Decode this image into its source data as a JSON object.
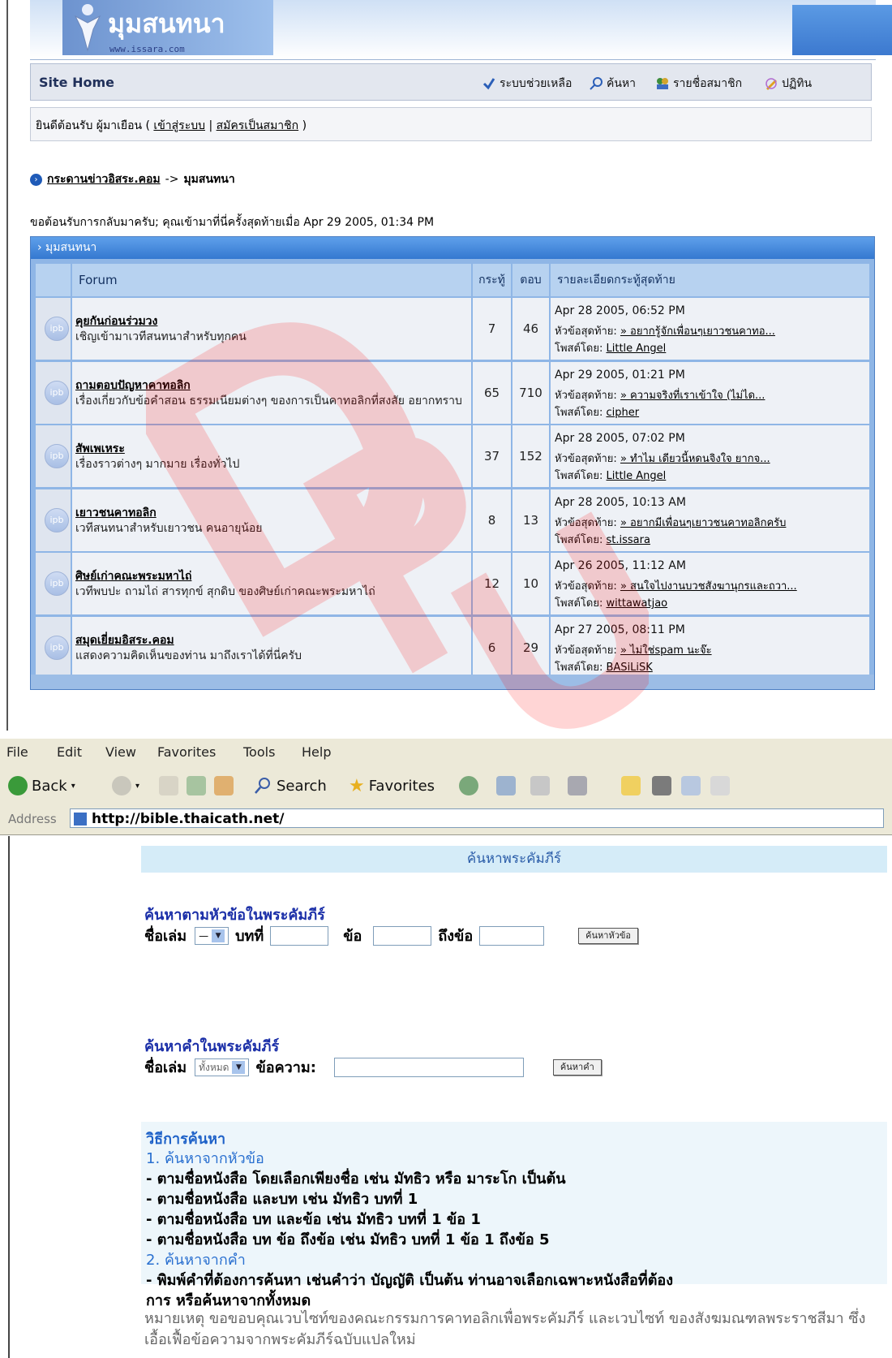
{
  "forum": {
    "site_title": "มุมสนทนา",
    "site_url": "www.issara.com",
    "nav": {
      "home": "Site Home",
      "help": "ระบบช่วยเหลือ",
      "search": "ค้นหา",
      "members": "รายชื่อสมาชิก",
      "calendar": "ปฏิทิน"
    },
    "welcome": {
      "prefix": "ยินดีต้อนรับ ผู้มาเยือน (",
      "login": "เข้าสู่ระบบ",
      "sep": "|",
      "register": "สมัครเป็นสมาชิก",
      "suffix": ")"
    },
    "breadcrumb": {
      "root": "กระดานข่าวอิสระ.คอม",
      "arrow": "->",
      "current": "มุมสนทนา"
    },
    "last_visit": "ขอต้อนรับการกลับมาครับ; คุณเข้ามาที่นี่ครั้งสุดท้ายเมื่อ Apr 29 2005, 01:34 PM",
    "table": {
      "title": "› มุมสนทนา",
      "headers": {
        "forum": "Forum",
        "topics": "กระทู้",
        "replies": "ตอบ",
        "last_post": "รายละเอียดกระทู้สุดท้าย"
      },
      "last_topic_label": "หัวข้อสุดท้าย:",
      "posted_by_label": "โพสต์โดย:",
      "rows": [
        {
          "title": "คุยกันก่อนร่วมวง",
          "desc": "เชิญเข้ามาเวทีสนทนาสำหรับทุกคน",
          "topics": "7",
          "replies": "46",
          "date": "Apr 28 2005, 06:52 PM",
          "last_topic": "» อยากรู้จักเพื่อนๆเยาวชนคาทอ...",
          "author": "Little Angel"
        },
        {
          "title": "ถามตอบปัญหาคาทอลิก",
          "desc": "เรื่องเกี่ยวกับข้อคำสอน ธรรมเนียมต่างๆ ของการเป็นคาทอลิกที่สงสัย อยากทราบ",
          "topics": "65",
          "replies": "710",
          "date": "Apr 29 2005, 01:21 PM",
          "last_topic": "» ความจริงที่เราเข้าใจ (ไม่ได...",
          "author": "cipher"
        },
        {
          "title": "สัพเพเหระ",
          "desc": "เรื่องราวต่างๆ มากมาย เรื่องทั่วไป",
          "topics": "37",
          "replies": "152",
          "date": "Apr 28 2005, 07:02 PM",
          "last_topic": "» ทำไม เดียวนี้หดนจิงใจ ยากจ...",
          "author": "Little Angel"
        },
        {
          "title": "เยาวชนคาทอลิก",
          "desc": "เวทีสนทนาสำหรับเยาวชน คนอายุน้อย",
          "topics": "8",
          "replies": "13",
          "date": "Apr 28 2005, 10:13 AM",
          "last_topic": "» อยากมีเพื่อนๆเยาวชนคาทอลิกครับ",
          "author": "st.issara"
        },
        {
          "title": "ศิษย์เก่าคณะพระมหาไถ่",
          "desc": "เวทีพบปะ ถามไถ่ สารทุกข์ สุกดิบ ของศิษย์เก่าคณะพระมหาไถ่",
          "topics": "12",
          "replies": "10",
          "date": "Apr 26 2005, 11:12 AM",
          "last_topic": "» สนใจไปงานบวชสังฆานุกรและถวา...",
          "author": "wittawatjao"
        },
        {
          "title": "สมุดเยี่ยมอิสระ.คอม",
          "desc": "แสดงความคิดเห็นของท่าน มาถึงเราได้ที่นี่ครับ",
          "topics": "6",
          "replies": "29",
          "date": "Apr 27 2005, 08:11 PM",
          "last_topic": "» ไม่ใช่spam นะจ๊ะ",
          "author": "BASiLiSK"
        }
      ]
    }
  },
  "browser": {
    "menu": [
      "File",
      "Edit",
      "View",
      "Favorites",
      "Tools",
      "Help"
    ],
    "toolbar": {
      "back": "Back",
      "search": "Search",
      "favorites": "Favorites"
    },
    "address_label": "Address",
    "address_url": "http://bible.thaicath.net/",
    "page": {
      "header": "ค้นหาพระคัมภีร์",
      "topic_search_title": "ค้นหาตามหัวข้อในพระคัมภีร์",
      "book_label": "ชื่อเล่ม",
      "book_default": "—",
      "chapter_label": "บทที่",
      "verse_label": "ข้อ",
      "to_verse_label": "ถึงข้อ",
      "topic_button": "ค้นหาหัวข้อ",
      "word_search_title": "ค้นหาคำในพระคัมภีร์",
      "word_book_default": "ทั้งหมด",
      "message_label": "ข้อความ:",
      "word_button": "ค้นหาคำ",
      "how_title": "วิธีการค้นหา",
      "how_lines": [
        {
          "text": "1. ค้นหาจากหัวข้อ",
          "style": "step"
        },
        {
          "text": "- ตามชื่อหนังสือ โดยเลือกเพียงชื่อ เช่น มัทธิว หรือ มาระโก เป็นต้น",
          "style": "plain"
        },
        {
          "text": "- ตามชื่อหนังสือ และบท เช่น มัทธิว บทที่ 1",
          "style": "plain"
        },
        {
          "text": "- ตามชื่อหนังสือ บท และข้อ เช่น มัทธิว บทที่ 1 ข้อ 1",
          "style": "plain"
        },
        {
          "text": "- ตามชื่อหนังสือ บท ข้อ ถึงข้อ เช่น มัทธิว บทที่ 1 ข้อ 1 ถึงข้อ 5",
          "style": "plain"
        },
        {
          "text": "2. ค้นหาจากคำ",
          "style": "step"
        },
        {
          "text": "- พิมพ์คำที่ต้องการค้นหา เช่นคำว่า บัญญัติ เป็นต้น ท่านอาจเลือกเฉพาะหนังสือที่ต้อง",
          "style": "plain"
        },
        {
          "text": "การ หรือค้นหาจากทั้งหมด",
          "style": "plain"
        }
      ],
      "note": "หมายเหตุ ขอขอบคุณเวบไซท์ของคณะกรรมการคาทอลิกเพื่อพระคัมภีร์ และเวบไซท์ ของสังฆมณฑลพระราชสีมา ซึ่งเอื้อเฟื้อข้อความจากพระคัมภีร์ฉบับแปลใหม่"
    }
  },
  "watermark": "DPU"
}
